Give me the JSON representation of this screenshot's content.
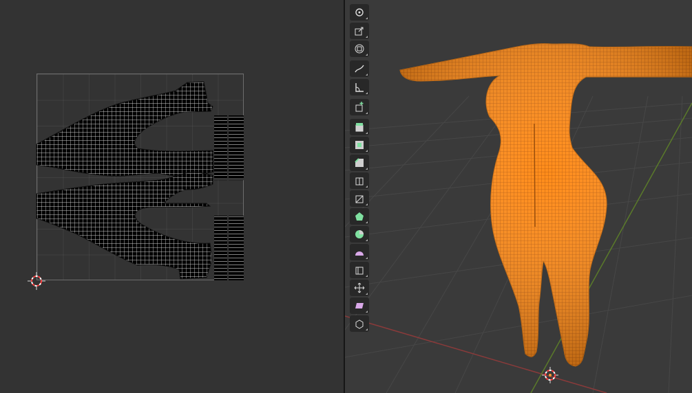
{
  "colors": {
    "uv_background": "#333333",
    "viewport_background": "#3a3a3a",
    "mesh_selected": "#ff8c1a",
    "uv_islands": "#000000",
    "uv_edges": "#d8d8d8",
    "axis_x": "#8a3a3a",
    "axis_y": "#5a7a2a",
    "toolbar_button": "#282828"
  },
  "uv_editor": {
    "islands": [
      "torso-leg-island-top",
      "torso-leg-island-bottom",
      "arm-strip-top",
      "arm-strip-bottom"
    ]
  },
  "viewport": {
    "object": "character-mesh",
    "mode": "edit"
  },
  "toolbar": {
    "tools": [
      {
        "icon": "rotate-icon"
      },
      {
        "icon": "scale-icon"
      },
      {
        "icon": "transform-icon"
      },
      {
        "icon": "annotate-icon"
      },
      {
        "icon": "measure-icon"
      },
      {
        "icon": "add-cube-icon"
      },
      {
        "icon": "extrude-region-icon"
      },
      {
        "icon": "inset-faces-icon"
      },
      {
        "icon": "bevel-icon"
      },
      {
        "icon": "loop-cut-icon"
      },
      {
        "icon": "knife-icon"
      },
      {
        "icon": "poly-build-icon"
      },
      {
        "icon": "spin-icon"
      },
      {
        "icon": "smooth-icon"
      },
      {
        "icon": "edge-slide-icon"
      },
      {
        "icon": "shrink-fatten-icon"
      },
      {
        "icon": "shear-icon"
      },
      {
        "icon": "rip-region-icon"
      }
    ]
  }
}
